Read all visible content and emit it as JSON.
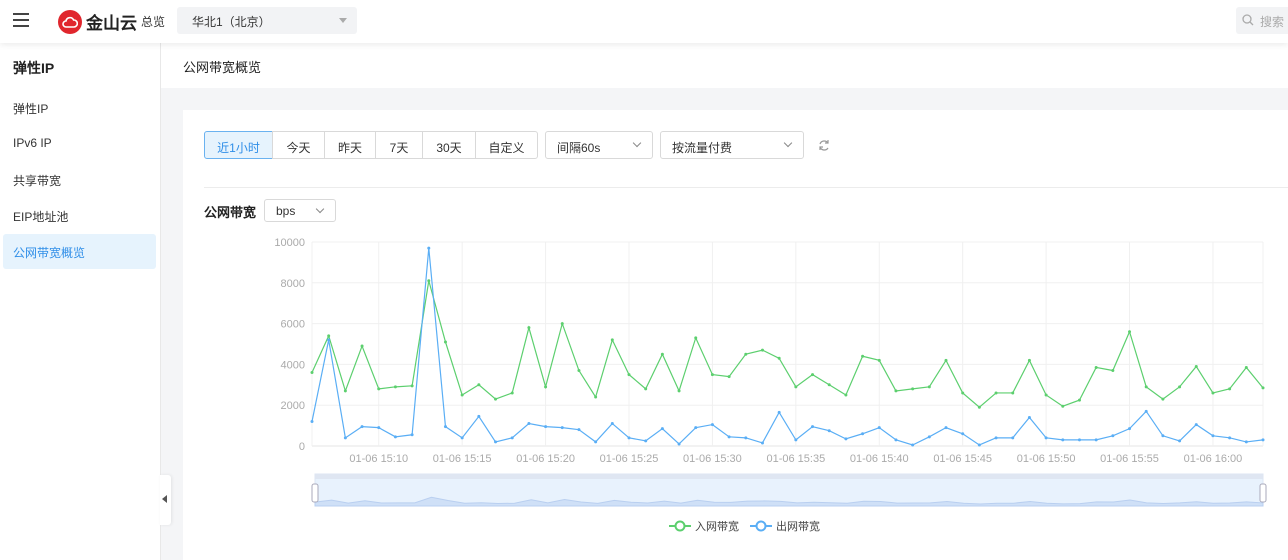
{
  "topbar": {
    "brand": "金山云",
    "overview": "总览",
    "region": "华北1（北京）",
    "search_placeholder": "搜索"
  },
  "sidebar": {
    "title": "弹性IP",
    "items": [
      {
        "label": "弹性IP"
      },
      {
        "label": "IPv6 IP"
      },
      {
        "label": "共享带宽"
      },
      {
        "label": "EIP地址池"
      },
      {
        "label": "公网带宽概览",
        "active": true
      }
    ]
  },
  "page": {
    "title": "公网带宽概览"
  },
  "toolbar": {
    "ranges": [
      "近1小时",
      "今天",
      "昨天",
      "7天",
      "30天",
      "自定义"
    ],
    "active_range": "近1小时",
    "interval": "间隔60s",
    "billing": "按流量付费"
  },
  "chart_section": {
    "title": "公网带宽",
    "unit": "bps"
  },
  "colors": {
    "in": "#5ccf6e",
    "out": "#5aaef5",
    "accent": "#2f8ee8"
  },
  "chart_data": {
    "type": "line",
    "title": "公网带宽",
    "ylabel": "bps",
    "ylim": [
      0,
      10000
    ],
    "yticks": [
      "0",
      "2000",
      "4000",
      "6000",
      "8000",
      "10000"
    ],
    "x_start": "01-06 15:06",
    "x_step_minutes": 1,
    "xtick_labels": [
      "01-06 15:10",
      "01-06 15:15",
      "01-06 15:20",
      "01-06 15:25",
      "01-06 15:30",
      "01-06 15:35",
      "01-06 15:40",
      "01-06 15:45",
      "01-06 15:50",
      "01-06 15:55",
      "01-06 16:00"
    ],
    "legend_position": "bottom",
    "series": [
      {
        "name": "入网带宽",
        "values": [
          3600,
          5400,
          2700,
          4900,
          2800,
          2900,
          2950,
          8100,
          5100,
          2500,
          3000,
          2300,
          2600,
          5800,
          2900,
          6000,
          3700,
          2400,
          5200,
          3500,
          2800,
          4500,
          2700,
          5300,
          3500,
          3400,
          4500,
          4700,
          4300,
          2900,
          3500,
          3000,
          2500,
          4400,
          4200,
          2700,
          2800,
          2900,
          4200,
          2600,
          1900,
          2600,
          2600,
          4200,
          2500,
          1950,
          2250,
          3850,
          3700,
          5600,
          2900,
          2300,
          2900,
          3900,
          2600,
          2800,
          3850,
          2850
        ]
      },
      {
        "name": "出网带宽",
        "values": [
          1200,
          5200,
          400,
          950,
          900,
          450,
          550,
          9700,
          950,
          400,
          1450,
          200,
          400,
          1100,
          950,
          900,
          800,
          200,
          1100,
          400,
          250,
          850,
          100,
          900,
          1050,
          450,
          400,
          150,
          1650,
          300,
          950,
          750,
          350,
          600,
          900,
          300,
          50,
          450,
          900,
          600,
          50,
          400,
          400,
          1400,
          400,
          300,
          300,
          300,
          500,
          850,
          1700,
          500,
          250,
          1050,
          500,
          400,
          200,
          300
        ]
      }
    ]
  }
}
